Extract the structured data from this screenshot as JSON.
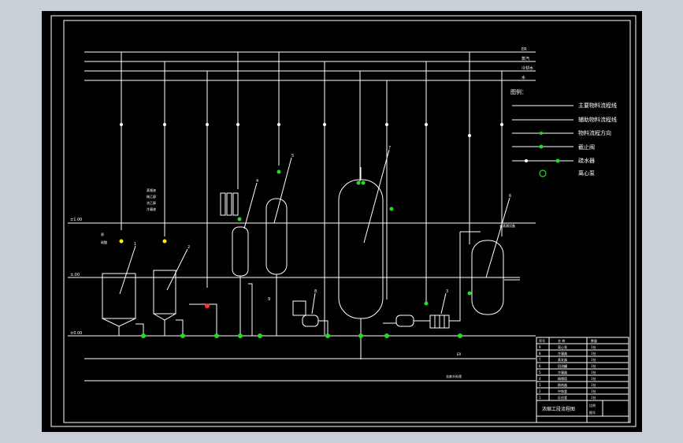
{
  "drawing": {
    "background_color": "#c9cfd6",
    "paper_color": "#000000",
    "line_color": "#ffffff",
    "accent_green": "#22dd22",
    "accent_yellow": "#ffee00",
    "accent_red": "#ff3333"
  },
  "utility_headers": [
    "ER",
    "蒸汽",
    "冷却水",
    "水"
  ],
  "legend": {
    "title": "图例：",
    "items": [
      "主要物料流程线",
      "辅助物料流程线",
      "物料流程方向",
      "截止阀",
      "疏水器",
      "离心泵"
    ]
  },
  "floor_levels": [
    "±1.00",
    "±.00",
    "±0.00"
  ],
  "equipment_tags": [
    "1",
    "2",
    "3",
    "4",
    "5",
    "6",
    "7",
    "8",
    "9"
  ],
  "inlet_labels": [
    "原",
    "硫酸"
  ],
  "feed_labels": [
    "蒸馏液",
    "稀乙醇",
    "浓乙醇",
    "冷凝液"
  ],
  "pipe_labels": [
    "去蒸馏设备",
    "ER",
    "去废水处理"
  ],
  "title_block": {
    "header": [
      "序号",
      "名  称",
      "数量"
    ],
    "rows": [
      [
        "9",
        "离心泵",
        "1台"
      ],
      [
        "8",
        "冷凝器",
        "1台"
      ],
      [
        "7",
        "蒸发器",
        "1台"
      ],
      [
        "6",
        "回流罐",
        "1台"
      ],
      [
        "5",
        "冷凝器",
        "1台"
      ],
      [
        "4",
        "精馏塔",
        "1台"
      ],
      [
        "3",
        "换热器",
        "1台"
      ],
      [
        "2",
        "中和釜",
        "1台"
      ],
      [
        "1",
        "反应釜",
        "1台"
      ]
    ],
    "drawing_title": "浓缩工段流程图",
    "fields": [
      "比例",
      "图号"
    ]
  }
}
